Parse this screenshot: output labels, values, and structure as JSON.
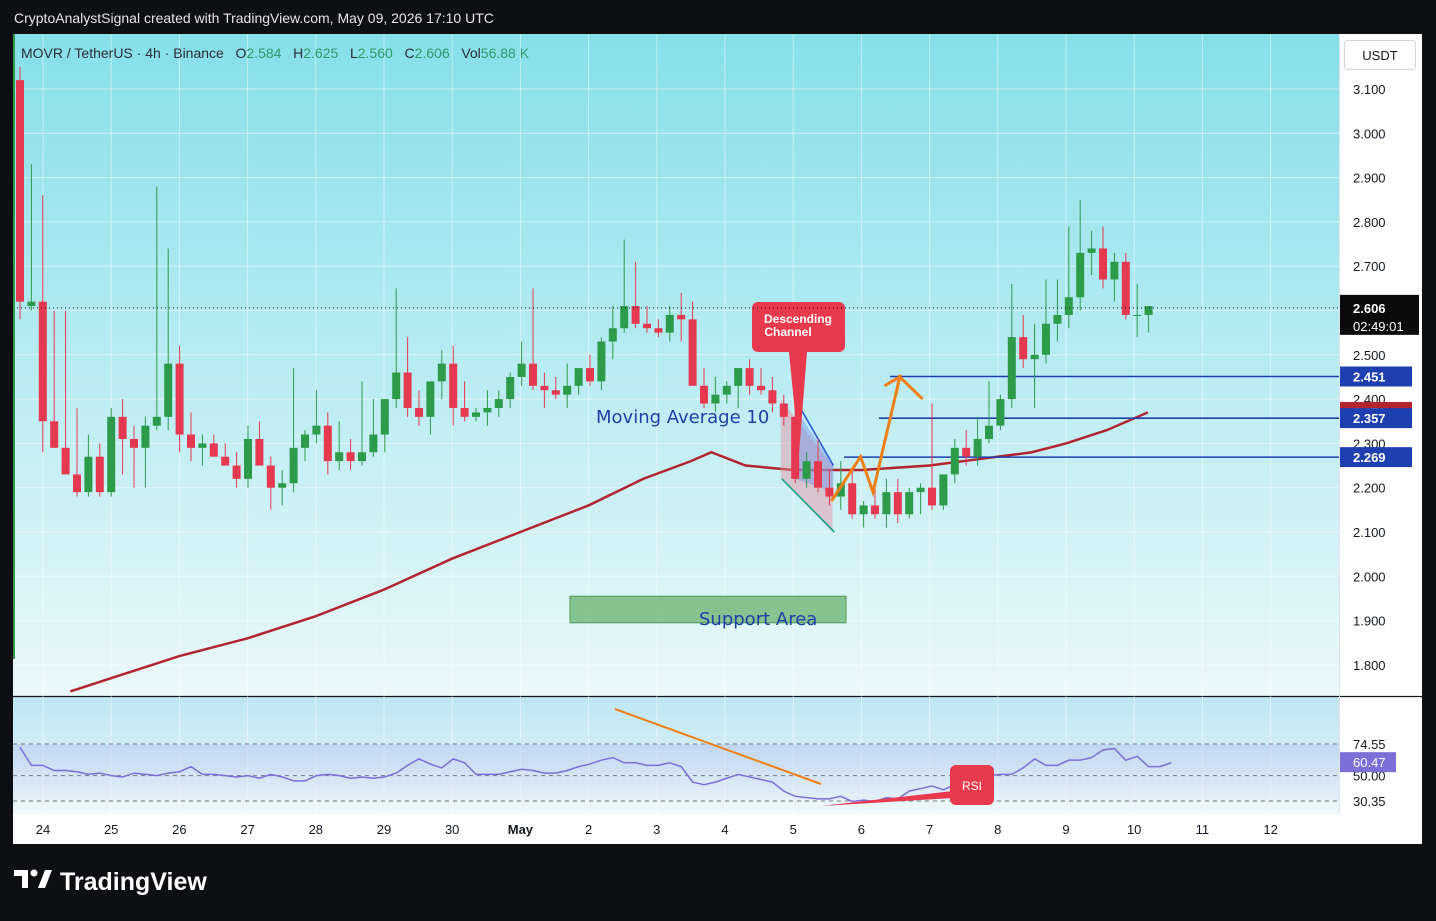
{
  "header": {
    "caption": "CryptoAnalystSignal created with TradingView.com, May 09, 2026 17:10 UTC"
  },
  "legend": {
    "symbol": "MOVR / TetherUS · 4h · Binance",
    "o_label": "O",
    "o_val": "2.584",
    "h_label": "H",
    "h_val": "2.625",
    "l_label": "L",
    "l_val": "2.560",
    "c_label": "C",
    "c_val": "2.606",
    "vol_label": "Vol",
    "vol_val": "56.88 K"
  },
  "currency": "USDT",
  "brand": {
    "name": "TradingView"
  },
  "colors": {
    "up": "#2e9b4a",
    "down": "#e53950",
    "ma": "#b3252e",
    "level": "#1e3fb0",
    "rsi": "#7c6fd8",
    "orange": "#f07f16",
    "support": "#67b26d",
    "callout": "#e83a4c"
  },
  "chart_data": [
    {
      "type": "candlestick",
      "title": "MOVR / TetherUS · 4h · Binance",
      "ylim": [
        1.74,
        3.22
      ],
      "y_ticks": [
        "3.100",
        "3.000",
        "2.900",
        "2.800",
        "2.700",
        "2.500",
        "2.400",
        "2.300",
        "2.200",
        "2.100",
        "2.000",
        "1.900",
        "1.800"
      ],
      "x_ticks": [
        "24",
        "25",
        "26",
        "27",
        "28",
        "29",
        "30",
        "May",
        "2",
        "3",
        "4",
        "5",
        "6",
        "7",
        "8",
        "9",
        "10",
        "11",
        "12"
      ],
      "last_price": "2.606",
      "countdown": "02:49:01",
      "price_levels": [
        {
          "label": "2.451",
          "value": 2.451,
          "color": "#1e3fb0"
        },
        {
          "label": "2.371",
          "value": 2.371,
          "color": "#b3252e"
        },
        {
          "label": "2.357",
          "value": 2.357,
          "color": "#1e3fb0"
        },
        {
          "label": "2.269",
          "value": 2.269,
          "color": "#1e3fb0"
        }
      ],
      "candles": [
        [
          3.12,
          3.15,
          2.58,
          2.62
        ],
        [
          2.61,
          2.93,
          2.6,
          2.62
        ],
        [
          2.62,
          2.86,
          2.28,
          2.35
        ],
        [
          2.35,
          2.6,
          2.3,
          2.29
        ],
        [
          2.29,
          2.6,
          2.23,
          2.23
        ],
        [
          2.23,
          2.38,
          2.18,
          2.19
        ],
        [
          2.19,
          2.32,
          2.18,
          2.27
        ],
        [
          2.27,
          2.3,
          2.18,
          2.19
        ],
        [
          2.19,
          2.38,
          2.18,
          2.36
        ],
        [
          2.36,
          2.4,
          2.23,
          2.31
        ],
        [
          2.31,
          2.34,
          2.2,
          2.29
        ],
        [
          2.29,
          2.36,
          2.2,
          2.34
        ],
        [
          2.34,
          2.88,
          2.33,
          2.36
        ],
        [
          2.36,
          2.74,
          2.33,
          2.48
        ],
        [
          2.48,
          2.52,
          2.28,
          2.32
        ],
        [
          2.32,
          2.37,
          2.26,
          2.29
        ],
        [
          2.29,
          2.32,
          2.25,
          2.3
        ],
        [
          2.3,
          2.32,
          2.27,
          2.27
        ],
        [
          2.27,
          2.3,
          2.25,
          2.25
        ],
        [
          2.25,
          2.28,
          2.2,
          2.22
        ],
        [
          2.22,
          2.34,
          2.2,
          2.31
        ],
        [
          2.31,
          2.35,
          2.26,
          2.25
        ],
        [
          2.25,
          2.27,
          2.15,
          2.2
        ],
        [
          2.2,
          2.24,
          2.16,
          2.21
        ],
        [
          2.21,
          2.47,
          2.19,
          2.29
        ],
        [
          2.29,
          2.33,
          2.26,
          2.32
        ],
        [
          2.32,
          2.42,
          2.3,
          2.34
        ],
        [
          2.34,
          2.37,
          2.23,
          2.26
        ],
        [
          2.26,
          2.35,
          2.24,
          2.28
        ],
        [
          2.28,
          2.31,
          2.24,
          2.26
        ],
        [
          2.26,
          2.44,
          2.25,
          2.28
        ],
        [
          2.28,
          2.4,
          2.27,
          2.32
        ],
        [
          2.32,
          2.37,
          2.28,
          2.4
        ],
        [
          2.4,
          2.65,
          2.38,
          2.46
        ],
        [
          2.46,
          2.54,
          2.36,
          2.38
        ],
        [
          2.38,
          2.42,
          2.34,
          2.36
        ],
        [
          2.36,
          2.44,
          2.32,
          2.44
        ],
        [
          2.44,
          2.51,
          2.4,
          2.48
        ],
        [
          2.48,
          2.52,
          2.34,
          2.38
        ],
        [
          2.38,
          2.44,
          2.35,
          2.36
        ],
        [
          2.36,
          2.38,
          2.35,
          2.37
        ],
        [
          2.37,
          2.42,
          2.34,
          2.38
        ],
        [
          2.38,
          2.42,
          2.36,
          2.4
        ],
        [
          2.4,
          2.46,
          2.38,
          2.45
        ],
        [
          2.45,
          2.53,
          2.43,
          2.48
        ],
        [
          2.48,
          2.65,
          2.42,
          2.43
        ],
        [
          2.43,
          2.46,
          2.38,
          2.42
        ],
        [
          2.42,
          2.45,
          2.4,
          2.41
        ],
        [
          2.41,
          2.48,
          2.38,
          2.43
        ],
        [
          2.43,
          2.47,
          2.41,
          2.47
        ],
        [
          2.47,
          2.5,
          2.43,
          2.44
        ],
        [
          2.44,
          2.54,
          2.42,
          2.53
        ],
        [
          2.53,
          2.61,
          2.49,
          2.56
        ],
        [
          2.56,
          2.76,
          2.55,
          2.61
        ],
        [
          2.61,
          2.71,
          2.56,
          2.57
        ],
        [
          2.57,
          2.61,
          2.55,
          2.56
        ],
        [
          2.56,
          2.58,
          2.54,
          2.55
        ],
        [
          2.55,
          2.61,
          2.53,
          2.59
        ],
        [
          2.59,
          2.64,
          2.53,
          2.58
        ],
        [
          2.58,
          2.62,
          2.44,
          2.43
        ],
        [
          2.43,
          2.47,
          2.38,
          2.39
        ],
        [
          2.39,
          2.45,
          2.37,
          2.41
        ],
        [
          2.41,
          2.44,
          2.39,
          2.43
        ],
        [
          2.43,
          2.47,
          2.38,
          2.47
        ],
        [
          2.47,
          2.49,
          2.41,
          2.43
        ],
        [
          2.43,
          2.47,
          2.41,
          2.42
        ],
        [
          2.42,
          2.45,
          2.37,
          2.39
        ],
        [
          2.39,
          2.41,
          2.34,
          2.36
        ],
        [
          2.36,
          2.38,
          2.21,
          2.22
        ],
        [
          2.22,
          2.28,
          2.2,
          2.26
        ],
        [
          2.26,
          2.31,
          2.19,
          2.2
        ],
        [
          2.2,
          2.24,
          2.16,
          2.18
        ],
        [
          2.18,
          2.26,
          2.15,
          2.21
        ],
        [
          2.21,
          2.24,
          2.13,
          2.14
        ],
        [
          2.14,
          2.17,
          2.11,
          2.16
        ],
        [
          2.16,
          2.21,
          2.13,
          2.14
        ],
        [
          2.14,
          2.22,
          2.11,
          2.19
        ],
        [
          2.19,
          2.22,
          2.12,
          2.14
        ],
        [
          2.14,
          2.2,
          2.13,
          2.19
        ],
        [
          2.19,
          2.21,
          2.14,
          2.2
        ],
        [
          2.2,
          2.39,
          2.15,
          2.16
        ],
        [
          2.16,
          2.23,
          2.15,
          2.23
        ],
        [
          2.23,
          2.31,
          2.21,
          2.29
        ],
        [
          2.29,
          2.33,
          2.25,
          2.27
        ],
        [
          2.27,
          2.36,
          2.25,
          2.31
        ],
        [
          2.31,
          2.44,
          2.3,
          2.34
        ],
        [
          2.34,
          2.41,
          2.33,
          2.4
        ],
        [
          2.4,
          2.66,
          2.38,
          2.54
        ],
        [
          2.54,
          2.59,
          2.47,
          2.49
        ],
        [
          2.49,
          2.57,
          2.38,
          2.5
        ],
        [
          2.5,
          2.67,
          2.48,
          2.57
        ],
        [
          2.57,
          2.67,
          2.53,
          2.59
        ],
        [
          2.59,
          2.79,
          2.56,
          2.63
        ],
        [
          2.63,
          2.85,
          2.6,
          2.73
        ],
        [
          2.73,
          2.78,
          2.68,
          2.74
        ],
        [
          2.74,
          2.79,
          2.65,
          2.67
        ],
        [
          2.67,
          2.73,
          2.62,
          2.71
        ],
        [
          2.71,
          2.73,
          2.58,
          2.59
        ],
        [
          2.59,
          2.66,
          2.54,
          2.59
        ],
        [
          2.59,
          2.61,
          2.55,
          2.61
        ]
      ],
      "ma_name": "Moving Average 10",
      "ma_points": [
        [
          24.4,
          1.74
        ],
        [
          26.0,
          1.82
        ],
        [
          27.0,
          1.86
        ],
        [
          28.0,
          1.91
        ],
        [
          29.0,
          1.97
        ],
        [
          30.0,
          2.04
        ],
        [
          31.0,
          2.1
        ],
        [
          32.0,
          2.16
        ],
        [
          32.8,
          2.22
        ],
        [
          33.5,
          2.26
        ],
        [
          33.8,
          2.28
        ],
        [
          34.3,
          2.25
        ],
        [
          35.0,
          2.24
        ],
        [
          36.0,
          2.24
        ],
        [
          37.0,
          2.25
        ],
        [
          38.0,
          2.27
        ],
        [
          38.5,
          2.28
        ],
        [
          39.0,
          2.3
        ],
        [
          39.6,
          2.33
        ],
        [
          40.2,
          2.37
        ]
      ],
      "annotations": [
        "Descending Channel",
        "Moving Average 10",
        "Support Area",
        "RSI"
      ]
    },
    {
      "type": "line",
      "title": "RSI",
      "ylim": [
        26,
        86
      ],
      "y_ticks": [
        "74.55",
        "50.00",
        "30.35"
      ],
      "current": "60.47",
      "values": [
        72,
        58,
        58,
        54,
        54,
        53,
        51,
        52,
        50,
        49,
        52,
        51,
        50,
        52,
        53,
        57,
        51,
        51,
        50,
        49,
        50,
        48,
        51,
        49,
        46,
        46,
        50,
        51,
        50,
        48,
        49,
        48,
        49,
        52,
        58,
        63,
        59,
        56,
        63,
        60,
        51,
        51,
        51,
        53,
        55,
        54,
        52,
        52,
        54,
        57,
        59,
        62,
        64,
        60,
        60,
        58,
        58,
        60,
        57,
        45,
        43,
        45,
        48,
        51,
        49,
        47,
        45,
        38,
        34,
        33,
        32,
        32,
        34,
        30,
        31,
        30,
        33,
        32,
        38,
        40,
        42,
        39,
        43,
        46,
        45,
        50,
        51,
        51,
        56,
        63,
        58,
        58,
        62,
        62,
        64,
        70,
        71,
        62,
        65,
        57,
        57,
        60
      ]
    }
  ]
}
